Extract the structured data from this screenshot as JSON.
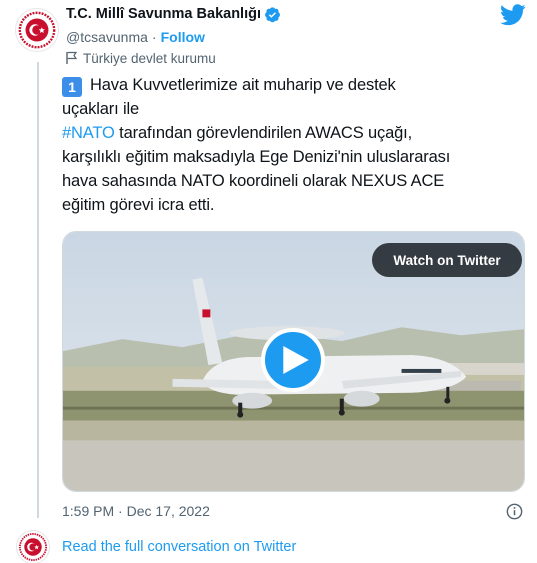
{
  "author": {
    "display_name": "T.C. Millî Savunma Bakanlığı",
    "handle": "@tcsavunma",
    "separator": "·",
    "follow_label": "Follow",
    "account_label": "Türkiye devlet kurumu",
    "verified_icon": "verified-badge-icon",
    "label_icon": "flag-icon"
  },
  "brand": {
    "logo_icon": "twitter-bird-icon",
    "accent_color": "#1d9bf0"
  },
  "tweet": {
    "keycap": "1",
    "line1": "Hava Kuvvetlerimize ait muharip ve destek",
    "line2": "uçakları ile",
    "hashtag": "#NATO",
    "line3_rest": " tarafından görevlendirilen AWACS uçağı,",
    "line4": "karşılıklı eğitim maksadıyla Ege Denizi'nin uluslararası",
    "line5": "hava sahasında NATO koordineli olarak NEXUS ACE",
    "line6": "eğitim görevi icra etti."
  },
  "media": {
    "watch_label": "Watch on Twitter",
    "play_icon": "play-icon"
  },
  "footer": {
    "timestamp": "1:59 PM · Dec 17, 2022",
    "info_icon": "info-icon",
    "read_more": "Read the full conversation on Twitter"
  }
}
